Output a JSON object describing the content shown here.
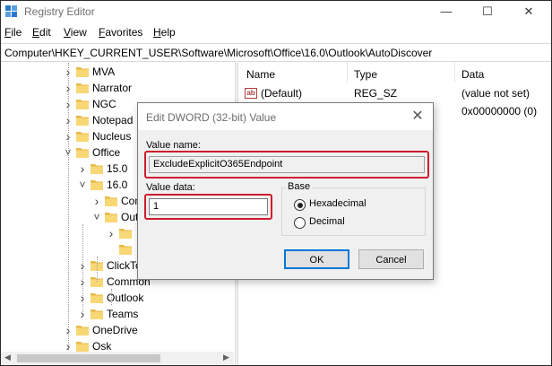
{
  "window": {
    "title": "Registry Editor",
    "min_glyph": "—",
    "max_glyph": "☐",
    "close_glyph": "✕"
  },
  "menu": [
    {
      "label": "File",
      "accel": "F",
      "rest": "ile"
    },
    {
      "label": "Edit",
      "accel": "E",
      "rest": "dit"
    },
    {
      "label": "View",
      "accel": "V",
      "rest": "iew"
    },
    {
      "label": "Favorites",
      "accel": "F",
      "rest": "avorites"
    },
    {
      "label": "Help",
      "accel": "H",
      "rest": "elp"
    }
  ],
  "address": "Computer\\HKEY_CURRENT_USER\\Software\\Microsoft\\Office\\16.0\\Outlook\\AutoDiscover",
  "tree": {
    "items": [
      {
        "label": "MVA",
        "expander": ">",
        "depth": 0
      },
      {
        "label": "Narrator",
        "expander": ">",
        "depth": 0
      },
      {
        "label": "NGC",
        "expander": ">",
        "depth": 0
      },
      {
        "label": "Notepad",
        "expander": ">",
        "depth": 0
      },
      {
        "label": "Nucleus",
        "expander": ">",
        "depth": 0
      },
      {
        "label": "Office",
        "expander": "v",
        "depth": 0
      },
      {
        "label": "15.0",
        "expander": ">",
        "depth": 1
      },
      {
        "label": "16.0",
        "expander": "v",
        "depth": 1
      },
      {
        "label": "Com",
        "expander": ">",
        "depth": 2
      },
      {
        "label": "Outl",
        "expander": "v",
        "depth": 2
      },
      {
        "label": "",
        "expander": ">",
        "depth": 3
      },
      {
        "label": "",
        "expander": "",
        "depth": 3
      },
      {
        "label": "ClickTo",
        "expander": ">",
        "depth": 1
      },
      {
        "label": "Common",
        "expander": ">",
        "depth": 1
      },
      {
        "label": "Outlook",
        "expander": ">",
        "depth": 1
      },
      {
        "label": "Teams",
        "expander": ">",
        "depth": 1
      },
      {
        "label": "OneDrive",
        "expander": ">",
        "depth": 0
      },
      {
        "label": "Osk",
        "expander": ">",
        "depth": 0
      }
    ]
  },
  "list": {
    "columns": [
      "Name",
      "Type",
      "Data"
    ],
    "rows": [
      {
        "name": "(Default)",
        "type": "REG_SZ",
        "data": "(value not set)",
        "icon": "ab"
      },
      {
        "name": "",
        "type": "",
        "data": "0x00000000 (0)",
        "icon": ""
      }
    ]
  },
  "dialog": {
    "title": "Edit DWORD (32-bit) Value",
    "close_glyph": "✕",
    "value_name_label": "Value name:",
    "value_name": "ExcludeExplicitO365Endpoint",
    "value_data_label": "Value data:",
    "value_data": "1",
    "base_label": "Base",
    "hex_label": "Hexadecimal",
    "dec_label": "Decimal",
    "selected_base": "Hexadecimal",
    "ok_label": "OK",
    "cancel_label": "Cancel",
    "highlight_color": "#cf1b2c"
  }
}
